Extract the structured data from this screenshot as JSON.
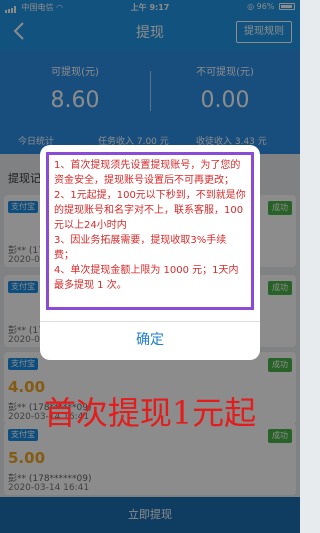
{
  "status_bar": {
    "carrier": "中国电信",
    "time": "上午 9:17",
    "battery": "96%"
  },
  "nav": {
    "title": "提现",
    "rules_button": "提现规则"
  },
  "summary": {
    "withdrawable_label": "可提现(元)",
    "withdrawable_amount": "8.60",
    "non_withdrawable_label": "不可提现(元)",
    "non_withdrawable_amount": "0.00",
    "today_stats": "今日统计",
    "task_income": "任务收入 7.00 元",
    "referral_income": "收徒收入 3.43 元"
  },
  "records_title": "提现记录",
  "records": [
    {
      "channel": "支付宝",
      "amount": "",
      "name": "彭** (178******09)",
      "date": "2020-03-14 16:41",
      "status": "成功"
    },
    {
      "channel": "支付宝",
      "amount": "",
      "name": "彭** (178******09)",
      "date": "2020-03-14 16:41",
      "status": "成功"
    },
    {
      "channel": "支付宝",
      "amount": "4.00",
      "name": "彭** (178******09)",
      "date": "2020-03-14 16:41",
      "status": "成功"
    },
    {
      "channel": "支付宝",
      "amount": "5.00",
      "name": "彭** (178******09)",
      "date": "2020-03-14 16:41",
      "status": "成功"
    }
  ],
  "dialog": {
    "rule1": "1、首次提现须先设置提现账号，为了您的资金安全，提现账号设置后不可再更改；",
    "rule2": "2、1元起提，100元以下秒到，不到就是你的提现账号和名字对不上，联系客服，100元以上24小时内",
    "rule3": "3、因业务拓展需要，提现收取3%手续费；",
    "rule4": "4、单次提现金额上限为 1000 元；1天内最多提现 1 次。",
    "confirm": "确定"
  },
  "overlay_caption": "首次提现1元起",
  "bottom_button": "立即提现"
}
